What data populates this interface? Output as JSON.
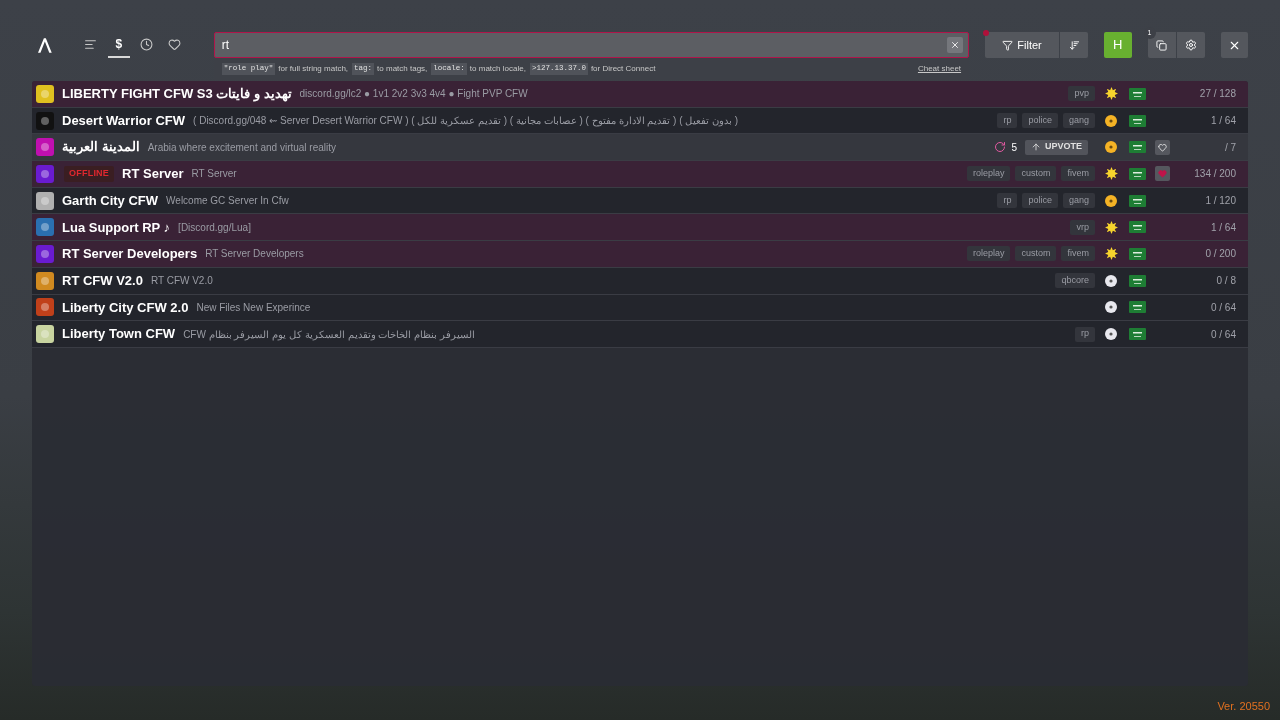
{
  "nav_tabs": [
    {
      "kind": "list",
      "selected": false
    },
    {
      "kind": "currency",
      "label": "$",
      "selected": true
    },
    {
      "kind": "clock",
      "selected": false
    },
    {
      "kind": "heart",
      "selected": false
    }
  ],
  "search": {
    "value": "rt",
    "hints": [
      {
        "code": "\"role play\"",
        "text": "for full string match,"
      },
      {
        "code": "tag:",
        "text": "to match tags,"
      },
      {
        "code": "locale:",
        "text": "to match locale,"
      },
      {
        "code": ">127.13.37.0",
        "text": "for Direct Connect"
      }
    ],
    "cheat_sheet": "Cheat sheet"
  },
  "filter_button": {
    "label": "Filter",
    "alert": true
  },
  "profile": {
    "initial": "H"
  },
  "notifications": {
    "count": "1"
  },
  "servers": [
    {
      "name": "LIBERTY FIGHT CFW S3 تهديد و فايتات",
      "description": "discord.gg/lc2 ● 1v1 2v2 3v3 4v4 ● Fight PVP CFW",
      "tags": [
        "pvp"
      ],
      "kind": "sun",
      "players": "27 / 128",
      "premium": true,
      "hovered": false,
      "color": "#e0c020"
    },
    {
      "name": "Desert Warrior CFW",
      "description": "( Discord.gg/048 ⇜ Server Desert Warrior CFW ) ( تقديم عسكرية للكل ) ( عصابات مجانية ) ( تقديم الادارة مفتوح ) ( بدون تفعيل )",
      "tags": [
        "rp",
        "police",
        "gang"
      ],
      "kind": "gold",
      "players": "1 / 64",
      "premium": false,
      "hovered": false,
      "color": "#111111"
    },
    {
      "name": "المدينة العربية",
      "description": "Arabia where excitement and virtual reality",
      "upvotes": "5",
      "upvote_label": "UPVOTE",
      "kind": "gold",
      "favorite": false,
      "players": "/ 7",
      "premium": false,
      "hovered": true,
      "color": "#c010b0"
    },
    {
      "name": "RT Server",
      "offline_label": "OFFLINE",
      "description": "RT Server",
      "tags": [
        "roleplay",
        "custom",
        "fivem"
      ],
      "kind": "sun",
      "favorite": true,
      "players": "134 / 200",
      "premium": true,
      "hovered": false,
      "color": "#6a1bd0"
    },
    {
      "name": "Garth City CFW",
      "description": "Welcome GC Server In Cfw",
      "tags": [
        "rp",
        "police",
        "gang"
      ],
      "kind": "gold",
      "players": "1 / 120",
      "premium": false,
      "hovered": false,
      "color": "#b0b0b0"
    },
    {
      "name": "Lua Support RP ♪",
      "description": "[Discord.gg/Lua]",
      "tags": [
        "vrp"
      ],
      "kind": "sun",
      "players": "1 / 64",
      "premium": true,
      "hovered": false,
      "color": "#2a6fb0"
    },
    {
      "name": "RT Server Developers",
      "description": "RT Server Developers",
      "tags": [
        "roleplay",
        "custom",
        "fivem"
      ],
      "kind": "sun",
      "players": "0 / 200",
      "premium": true,
      "hovered": false,
      "color": "#6a1bd0"
    },
    {
      "name": "RT CFW V2.0",
      "description": "RT CFW V2.0",
      "tags": [
        "qbcore"
      ],
      "kind": "silver",
      "players": "0 / 8",
      "premium": false,
      "hovered": false,
      "color": "#d08a20"
    },
    {
      "name": "Liberty City CFW 2.0",
      "description": "New Files New Experince",
      "kind": "silver",
      "players": "0 / 64",
      "premium": false,
      "hovered": false,
      "color": "#c0401a"
    },
    {
      "name": "Liberty Town CFW",
      "description": "السيرفر بنظام الخاخات وتقديم العسكرية كل يوم السيرفر بنظام CFW",
      "tags": [
        "rp"
      ],
      "kind": "silver",
      "players": "0 / 64",
      "premium": false,
      "hovered": false,
      "color": "#c8d4a0"
    }
  ],
  "version": "Ver. 20550"
}
